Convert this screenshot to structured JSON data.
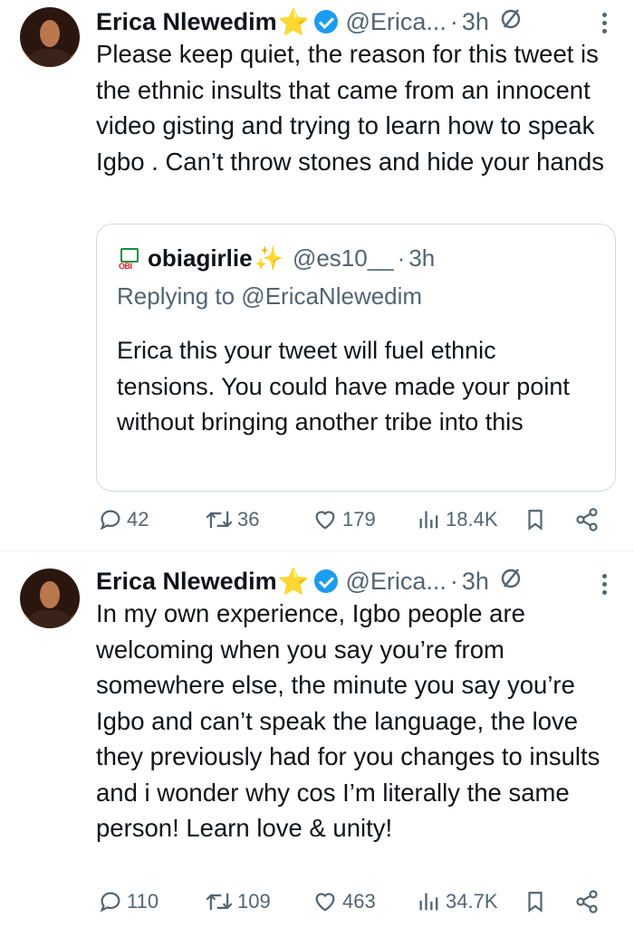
{
  "tweets": [
    {
      "name": "Erica Nlewedim",
      "name_emoji": "⭐",
      "handle": "@Erica...",
      "time": "3h",
      "text": "Please keep quiet, the reason for this tweet is the ethnic insults that came from an innocent video gisting and trying to learn how to speak Igbo . Can’t throw stones and hide your hands",
      "quote": {
        "flag_label": "OBI",
        "name": "obiagirlie",
        "name_emoji": "✨",
        "handle": "@es10__",
        "time": "3h",
        "replying_to": "Replying to @EricaNlewedim",
        "text": "Erica this your tweet will fuel ethnic tensions. You could have made your point without bringing another tribe into this"
      },
      "actions": {
        "replies": "42",
        "retweets": "36",
        "likes": "179",
        "views": "18.4K"
      }
    },
    {
      "name": "Erica Nlewedim",
      "name_emoji": "⭐",
      "handle": "@Erica...",
      "time": "3h",
      "text": "In my own experience, Igbo people are welcoming when you say you’re from somewhere else, the minute you say you’re Igbo and can’t speak the language, the love they previously had for you changes to insults and i wonder why cos I’m literally the same person! Learn love & unity!",
      "actions": {
        "replies": "110",
        "retweets": "109",
        "likes": "463",
        "views": "34.7K"
      }
    }
  ],
  "separator_dot": "·",
  "icons": [
    "reply-icon",
    "retweet-icon",
    "like-icon",
    "views-icon",
    "bookmark-icon",
    "share-icon",
    "verified-icon",
    "grok-icon",
    "more-icon"
  ],
  "colors": {
    "text": "#0f1419",
    "secondary": "#536471",
    "verified": "#1d9bf0",
    "border": "#cfd9de"
  }
}
